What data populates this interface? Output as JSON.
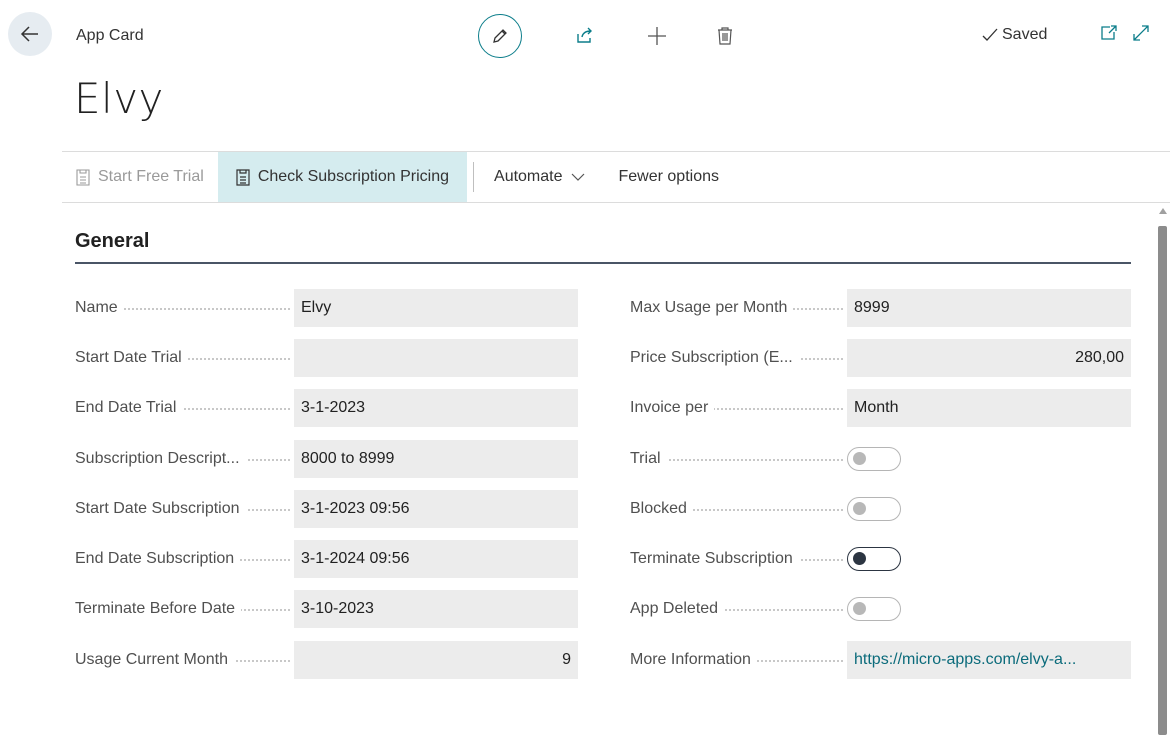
{
  "header": {
    "page_kind": "App Card",
    "title": "Elvy",
    "saved_label": "Saved"
  },
  "icons": {
    "back": "arrow-left-icon",
    "edit": "pencil-icon",
    "share": "share-icon",
    "add": "plus-icon",
    "delete": "trash-icon",
    "saved": "check-icon",
    "open_new": "open-in-new-window-icon",
    "expand": "expand-icon"
  },
  "actions": {
    "start_free_trial": "Start Free Trial",
    "check_pricing": "Check Subscription Pricing",
    "automate": "Automate",
    "fewer_options": "Fewer options"
  },
  "section": {
    "title": "General"
  },
  "left_fields": [
    {
      "label": "Name",
      "value": "Elvy"
    },
    {
      "label": "Start Date Trial",
      "value": ""
    },
    {
      "label": "End Date Trial",
      "value": "3-1-2023"
    },
    {
      "label": "Subscription Descript...",
      "value": "8000 to 8999"
    },
    {
      "label": "Start Date Subscription",
      "value": "3-1-2023 09:56"
    },
    {
      "label": "End Date Subscription",
      "value": "3-1-2024 09:56"
    },
    {
      "label": "Terminate Before Date",
      "value": "3-10-2023"
    },
    {
      "label": "Usage Current Month",
      "value": "9"
    }
  ],
  "right_fields": [
    {
      "label": "Max Usage per Month",
      "value": "8999"
    },
    {
      "label": "Price Subscription (E...",
      "value": "280,00"
    },
    {
      "label": "Invoice per",
      "value": "Month"
    },
    {
      "label": "Trial",
      "toggle": false
    },
    {
      "label": "Blocked",
      "toggle": false
    },
    {
      "label": "Terminate Subscription",
      "toggle": false
    },
    {
      "label": "App Deleted",
      "toggle": false
    },
    {
      "label": "More Information",
      "value": "https://micro-apps.com/elvy-a..."
    }
  ],
  "colors": {
    "accent": "#0b7d8a",
    "active_action_bg": "#d5ecef",
    "field_bg": "#ececec",
    "link": "#0b6b7b"
  }
}
